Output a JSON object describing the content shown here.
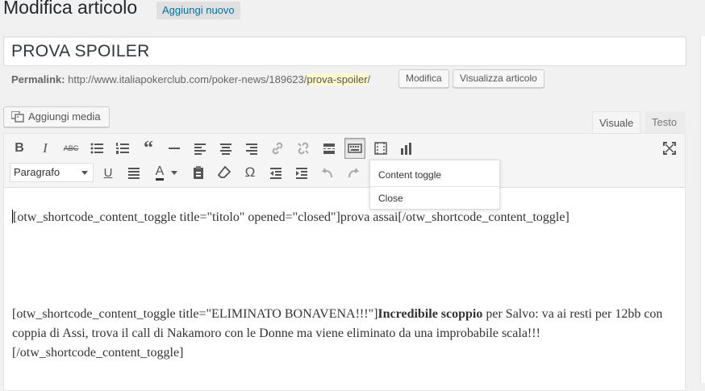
{
  "header": {
    "title": "Modifica articolo",
    "add_new": "Aggiungi nuovo"
  },
  "post": {
    "title": "PROVA SPOILER",
    "permalink_label": "Permalink:",
    "permalink_base": "http://www.italiapokerclub.com/poker-news/189623/",
    "permalink_slug": "prova-spoiler",
    "permalink_end": "/",
    "edit_button": "Modifica",
    "view_button": "Visualizza articolo"
  },
  "media": {
    "add_media": "Aggiungi media"
  },
  "tabs": {
    "visual": "Visuale",
    "text": "Testo"
  },
  "toolbar": {
    "format_select": "Paragrafo",
    "row1": [
      "bold",
      "italic",
      "strikethrough",
      "bullet-list",
      "numbered-list",
      "blockquote",
      "horizontal-rule",
      "align-left",
      "align-center",
      "align-right",
      "link",
      "unlink",
      "insert-more",
      "toolbar-toggle",
      "shortcode",
      "chart",
      "fullscreen"
    ],
    "row2": [
      "underline",
      "justify",
      "text-color",
      "paste-text",
      "clear-formatting",
      "special-char",
      "outdent",
      "indent",
      "undo",
      "redo"
    ]
  },
  "dropdown": {
    "items": [
      "Content toggle",
      "Close"
    ]
  },
  "content": {
    "p1": "[otw_shortcode_content_toggle title=\"titolo\" opened=\"closed\"]prova assai[/otw_shortcode_content_toggle]",
    "p2_a": "[otw_shortcode_content_toggle title=\"ELIMINATO BONAVENA!!!\"]",
    "p2_bold": "Incredibile scoppio",
    "p2_b": " per Salvo: va ai resti per 12bb con coppia di Assi, trova il call di Nakamoro con le Donne ma viene eliminato da una improbabile scala!!!",
    "p2_c": "[/otw_shortcode_content_toggle]"
  }
}
